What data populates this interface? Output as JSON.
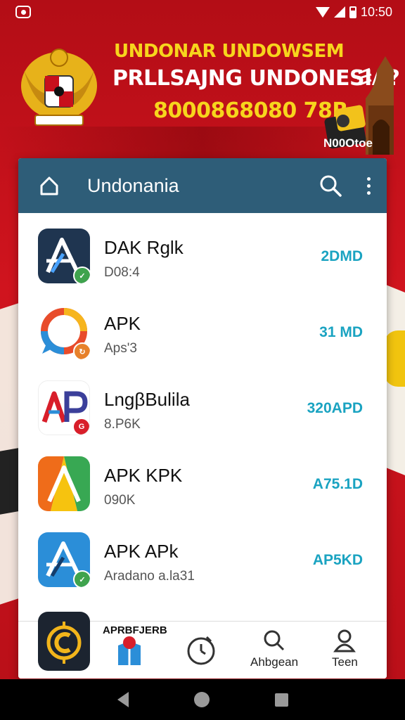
{
  "status_bar": {
    "time": "10:50"
  },
  "banner": {
    "line1": "UNDONAR UNDOWSEM",
    "line2": "PRLLSAJNG UNDONESIA?",
    "line3": "8000868080 78R",
    "tag": "N00Otoe"
  },
  "app_bar": {
    "title": "Undonania"
  },
  "apps": [
    {
      "name": "DAK Rglk",
      "sub": "D08:4",
      "size": "2DMD",
      "icon": "a-triangle-icon",
      "color": "#1f3550"
    },
    {
      "name": "APK",
      "sub": "Aps'3",
      "size": "31 MD",
      "icon": "chat-ring-icon",
      "color": "#ffffff"
    },
    {
      "name": "LngβBulila",
      "sub": "8.P6K",
      "size": "320APD",
      "icon": "ap-letters-icon",
      "color": "#ffffff"
    },
    {
      "name": "APK KPK",
      "sub": "090K",
      "size": "A75.1D",
      "icon": "play-triangle-icon",
      "color": "#ffffff"
    },
    {
      "name": "APK APk",
      "sub": "Aradano a.la31",
      "size": "AP5KD",
      "icon": "a-triangle-blue-icon",
      "color": "#2b8ed8"
    }
  ],
  "bottom_nav": {
    "label_top": "APRBFJERB",
    "items": [
      {
        "label": "",
        "icon": "shield-badge-icon"
      },
      {
        "label": "",
        "icon": "timer-icon"
      },
      {
        "label": "Ahbgean",
        "icon": "search-icon"
      },
      {
        "label": "Teen",
        "icon": "person-icon"
      }
    ]
  }
}
